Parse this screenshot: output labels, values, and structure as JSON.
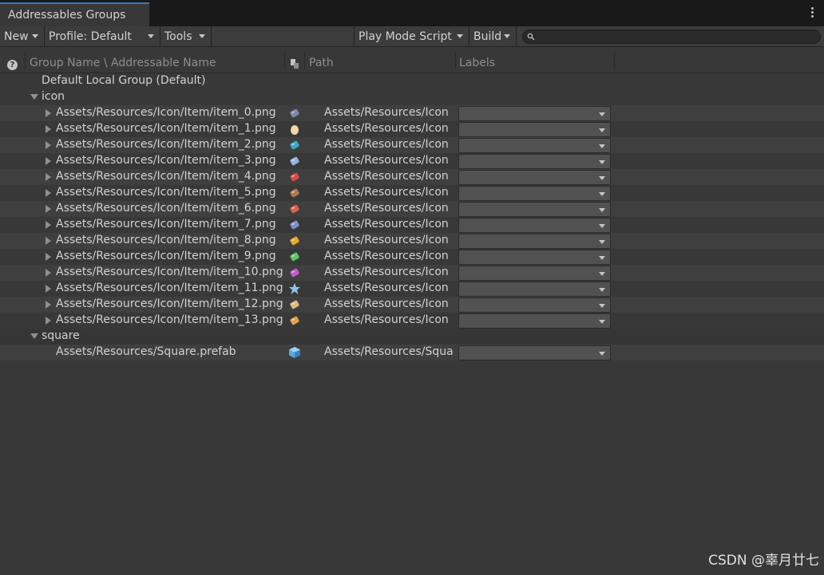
{
  "window": {
    "tab_title": "Addressables Groups"
  },
  "toolbar": {
    "new_label": "New",
    "profile_label": "Profile: Default",
    "tools_label": "Tools",
    "play_mode_label": "Play Mode Script",
    "build_label": "Build",
    "search_placeholder": "",
    "search_value": ""
  },
  "columns": {
    "name": "Group Name \\ Addressable Name",
    "path": "Path",
    "labels": "Labels"
  },
  "groups": {
    "default_group": "Default Local Group (Default)",
    "icon_group": "icon",
    "square_group": "square"
  },
  "icon_entries": [
    {
      "name": "Assets/Resources/Icon/Item/item_0.png",
      "path": "Assets/Resources/Icon",
      "icon": "boot-icon",
      "color": "#7a8aa8"
    },
    {
      "name": "Assets/Resources/Icon/Item/item_1.png",
      "path": "Assets/Resources/Icon",
      "icon": "egg-icon",
      "color": "#f0d7a8"
    },
    {
      "name": "Assets/Resources/Icon/Item/item_2.png",
      "path": "Assets/Resources/Icon",
      "icon": "feather-icon",
      "color": "#3fa9c9"
    },
    {
      "name": "Assets/Resources/Icon/Item/item_3.png",
      "path": "Assets/Resources/Icon",
      "icon": "wand-icon",
      "color": "#8fb4e0"
    },
    {
      "name": "Assets/Resources/Icon/Item/item_4.png",
      "path": "Assets/Resources/Icon",
      "icon": "book-icon",
      "color": "#d94b4b"
    },
    {
      "name": "Assets/Resources/Icon/Item/item_5.png",
      "path": "Assets/Resources/Icon",
      "icon": "log-icon",
      "color": "#b07a4f"
    },
    {
      "name": "Assets/Resources/Icon/Item/item_6.png",
      "path": "Assets/Resources/Icon",
      "icon": "meat-icon",
      "color": "#d6634a"
    },
    {
      "name": "Assets/Resources/Icon/Item/item_7.png",
      "path": "Assets/Resources/Icon",
      "icon": "crystal-icon",
      "color": "#7d93c7"
    },
    {
      "name": "Assets/Resources/Icon/Item/item_8.png",
      "path": "Assets/Resources/Icon",
      "icon": "cheese-icon",
      "color": "#e6a82c"
    },
    {
      "name": "Assets/Resources/Icon/Item/item_9.png",
      "path": "Assets/Resources/Icon",
      "icon": "leaf-icon",
      "color": "#5cc46a"
    },
    {
      "name": "Assets/Resources/Icon/Item/item_10.png",
      "path": "Assets/Resources/Icon",
      "icon": "potion-icon",
      "color": "#c05ac8"
    },
    {
      "name": "Assets/Resources/Icon/Item/item_11.png",
      "path": "Assets/Resources/Icon",
      "icon": "star-icon",
      "color": "#8fc0ec"
    },
    {
      "name": "Assets/Resources/Icon/Item/item_12.png",
      "path": "Assets/Resources/Icon",
      "icon": "coins-icon",
      "color": "#d8b98a"
    },
    {
      "name": "Assets/Resources/Icon/Item/item_13.png",
      "path": "Assets/Resources/Icon",
      "icon": "bread-icon",
      "color": "#e0a050"
    }
  ],
  "square_entries": [
    {
      "name": "Assets/Resources/Square.prefab",
      "path": "Assets/Resources/Squa",
      "icon": "prefab-cube-icon",
      "color": "#5aa8e0"
    }
  ],
  "watermark": "CSDN @辜月廿七"
}
